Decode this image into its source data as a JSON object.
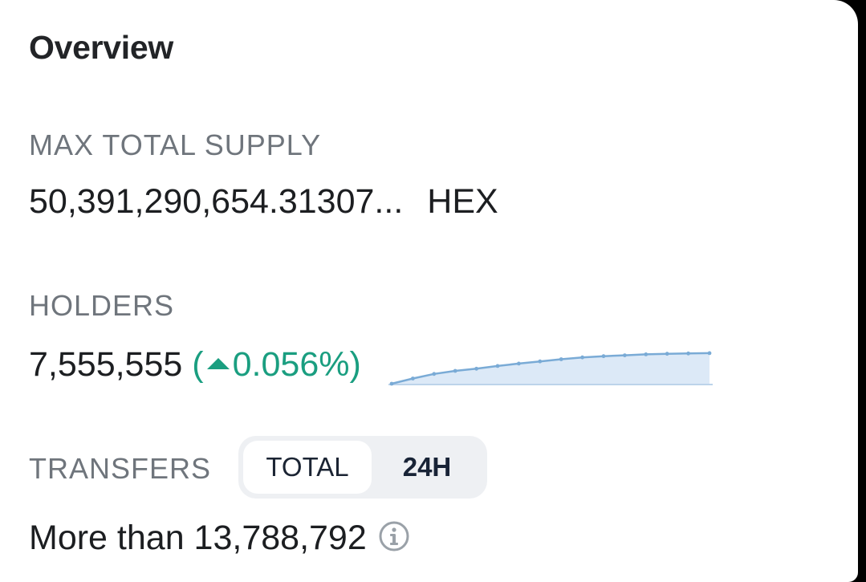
{
  "overview": {
    "title": "Overview"
  },
  "max_total_supply": {
    "label": "MAX TOTAL SUPPLY",
    "value": "50,391,290,654.31307...",
    "unit": "HEX"
  },
  "holders": {
    "label": "HOLDERS",
    "value": "7,555,555",
    "open_paren": "(",
    "change": "0.056%)",
    "change_direction": "up",
    "change_color": "#1a9e80",
    "sparkline_color": "#7aabd6",
    "sparkline_fill": "#dce9f7"
  },
  "chart_data": {
    "type": "area",
    "x": [
      0,
      1,
      2,
      3,
      4,
      5,
      6,
      7,
      8,
      9,
      10,
      11,
      12,
      13,
      14,
      15
    ],
    "values": [
      0,
      0.17,
      0.32,
      0.42,
      0.49,
      0.58,
      0.66,
      0.73,
      0.8,
      0.86,
      0.9,
      0.93,
      0.96,
      0.98,
      0.99,
      1.0
    ],
    "ylim": [
      0,
      1.05
    ]
  },
  "transfers": {
    "label": "TRANSFERS",
    "options": [
      "TOTAL",
      "24H"
    ],
    "selected": "TOTAL",
    "value": "More than 13,788,792"
  },
  "icons": {
    "info": "info-icon",
    "up_arrow": "triangle-up-icon"
  }
}
